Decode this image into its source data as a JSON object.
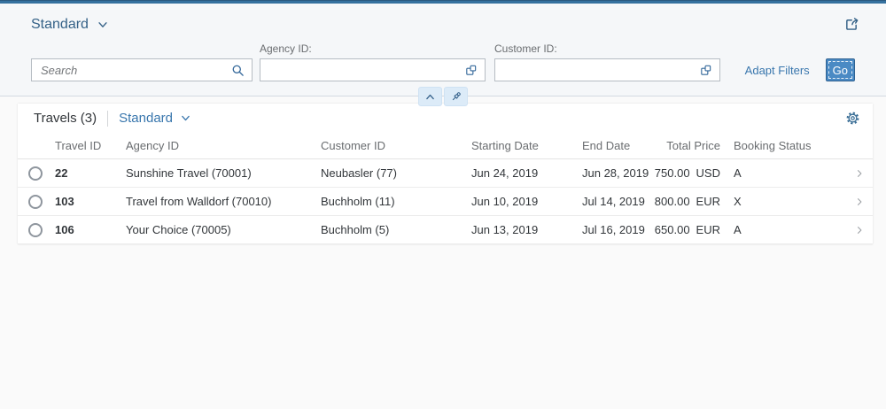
{
  "colors": {
    "accent_bar": "#35719f",
    "header_bg": "#f5f7f9",
    "title_blue": "#346187",
    "link_blue": "#3876ad",
    "go_button_bg": "#4a8ac4",
    "content_bg": "#fafafa"
  },
  "page": {
    "variant_title": "Standard"
  },
  "filter_bar": {
    "search_placeholder": "Search",
    "agency_label": "Agency ID:",
    "agency_value": "",
    "customer_label": "Customer ID:",
    "customer_value": "",
    "adapt_filters_label": "Adapt Filters",
    "go_label": "Go"
  },
  "table": {
    "title": "Travels (3)",
    "variant": "Standard",
    "columns": [
      "Travel ID",
      "Agency ID",
      "Customer ID",
      "Starting Date",
      "End Date",
      "Total Price",
      "Booking Status"
    ],
    "rows": [
      {
        "travel_id": "22",
        "agency_id": "Sunshine Travel (70001)",
        "customer_id": "Neubasler (77)",
        "starting_date": "Jun 24, 2019",
        "end_date": "Jun 28, 2019",
        "total_price": "750.00",
        "currency": "USD",
        "booking_status": "A"
      },
      {
        "travel_id": "103",
        "agency_id": "Travel from Walldorf (70010)",
        "customer_id": "Buchholm (11)",
        "starting_date": "Jun 10, 2019",
        "end_date": "Jul 14, 2019",
        "total_price": "800.00",
        "currency": "EUR",
        "booking_status": "X"
      },
      {
        "travel_id": "106",
        "agency_id": "Your Choice (70005)",
        "customer_id": "Buchholm (5)",
        "starting_date": "Jun 13, 2019",
        "end_date": "Jul 16, 2019",
        "total_price": "650.00",
        "currency": "EUR",
        "booking_status": "A"
      }
    ]
  },
  "icons": {
    "share": "share-icon",
    "value_help": "value-help-icon",
    "search": "search-icon",
    "collapse": "chevron-up-icon",
    "pin": "pin-icon",
    "settings": "gear-icon",
    "dropdown": "chevron-down-icon",
    "row_nav": "chevron-right-icon"
  }
}
